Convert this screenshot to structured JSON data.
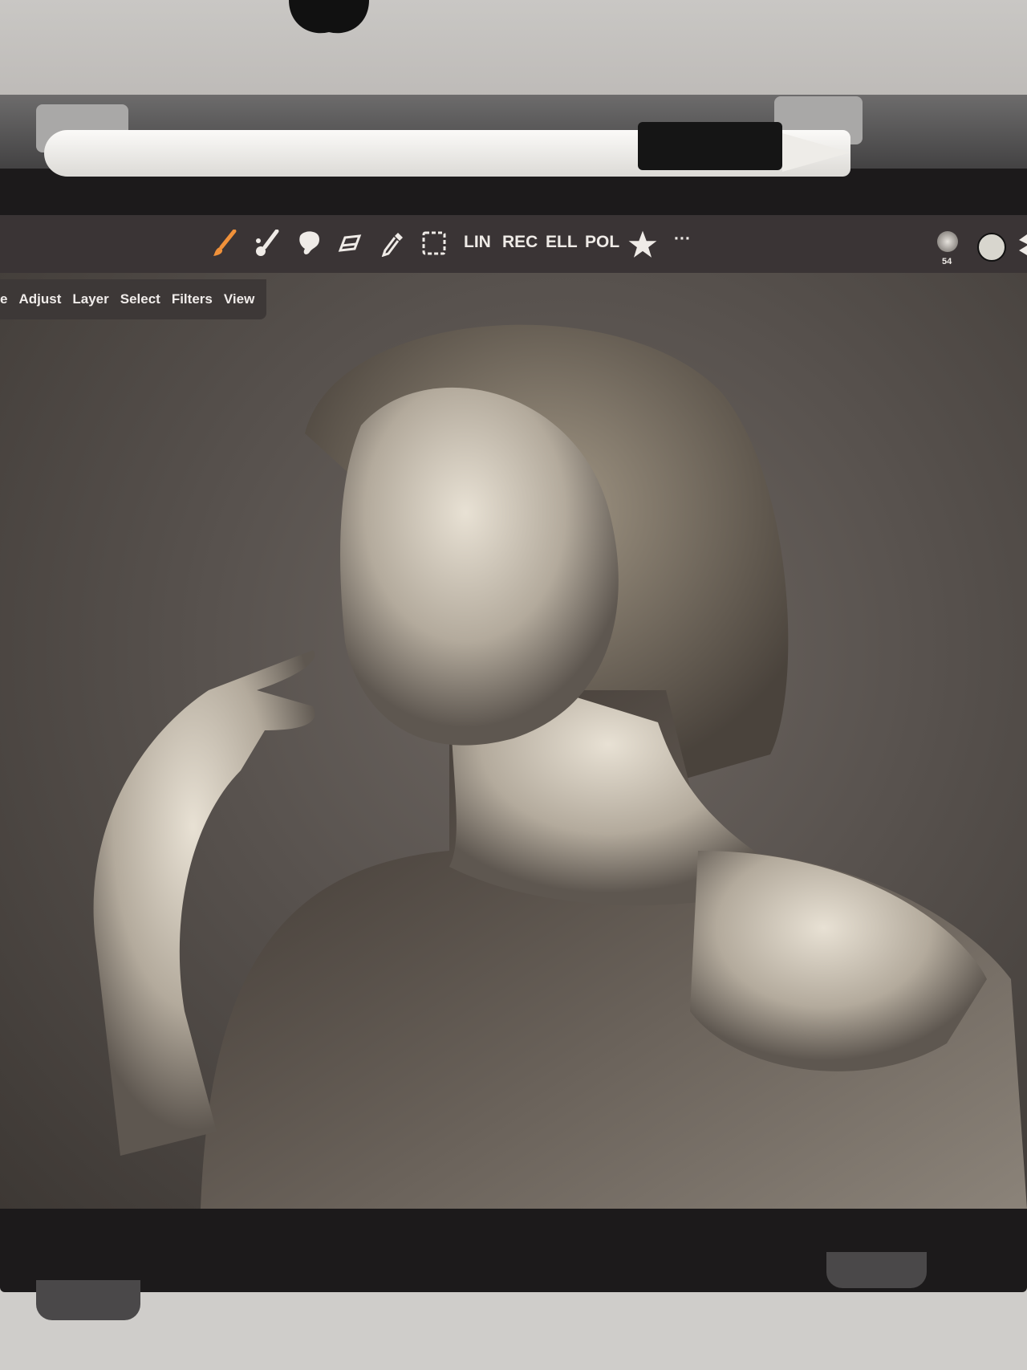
{
  "toolbar": {
    "tools": [
      {
        "name": "paint-brush",
        "label": ""
      },
      {
        "name": "blend-brush",
        "label": ""
      },
      {
        "name": "smudge",
        "label": ""
      },
      {
        "name": "eraser",
        "label": ""
      },
      {
        "name": "eyedropper",
        "label": ""
      },
      {
        "name": "selection",
        "label": ""
      }
    ],
    "shape_tools": [
      "LIN",
      "REC",
      "ELL",
      "POL"
    ],
    "more_label": "···",
    "brush_size": "54",
    "active_tool_color": "#f0913a",
    "current_color": "#d8d6ce"
  },
  "menu": {
    "items": [
      "e",
      "Adjust",
      "Layer",
      "Select",
      "Filters",
      "View"
    ]
  }
}
